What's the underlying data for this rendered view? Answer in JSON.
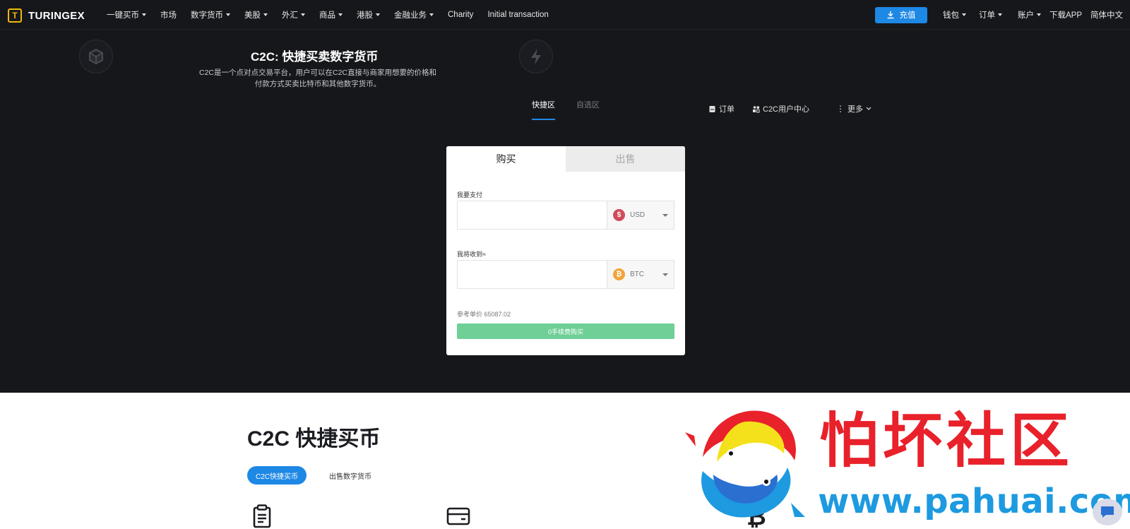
{
  "nav": {
    "brand": "TURINGEX",
    "items": [
      {
        "label": "一键买币",
        "dropdown": true
      },
      {
        "label": "市场",
        "dropdown": false
      },
      {
        "label": "数字货币",
        "dropdown": true
      },
      {
        "label": "美股",
        "dropdown": true
      },
      {
        "label": "外汇",
        "dropdown": true
      },
      {
        "label": "商品",
        "dropdown": true
      },
      {
        "label": "港股",
        "dropdown": true
      },
      {
        "label": "金融业务",
        "dropdown": true
      },
      {
        "label": "Charity",
        "dropdown": false
      },
      {
        "label": "Initial transaction",
        "dropdown": false
      }
    ],
    "recharge": "充值",
    "wallet": "钱包",
    "orders": "订单",
    "account": "账户",
    "download": "下载APP",
    "language": "简体中文"
  },
  "hero": {
    "title": "C2C: 快捷买卖数字货币",
    "description": "C2C是一个点对点交易平台，用户可以在C2C直接与商家用想要的价格和付款方式买卖比特币和其他数字货币。"
  },
  "sub_tabs": {
    "quick": "快捷区",
    "select": "自选区"
  },
  "sub_actions": {
    "orders": "订单",
    "user_center": "C2C用户中心",
    "more": "更多"
  },
  "card": {
    "tab_buy": "购买",
    "tab_sell": "出售",
    "pay_label": "我要支付",
    "pay_value": "",
    "pay_currency": "USD",
    "receive_label": "我将收到≈",
    "receive_value": "",
    "receive_currency": "BTC",
    "ref_price": "参考单价 65087.02",
    "buy_button": "0手续费购买"
  },
  "lower": {
    "title": "C2C 快捷买币",
    "tab_active": "C2C快捷买币",
    "tab_other": "出售数字货币"
  },
  "watermark": {
    "text": "怕坏社区",
    "url": "www.pahuai.com"
  },
  "colors": {
    "accent": "#1e88e5",
    "buy_button": "#6fcf97",
    "usd_coin": "#d14b5a",
    "btc_coin": "#f2a33a",
    "watermark_red": "#e8212a",
    "watermark_blue": "#1d9ae0"
  }
}
